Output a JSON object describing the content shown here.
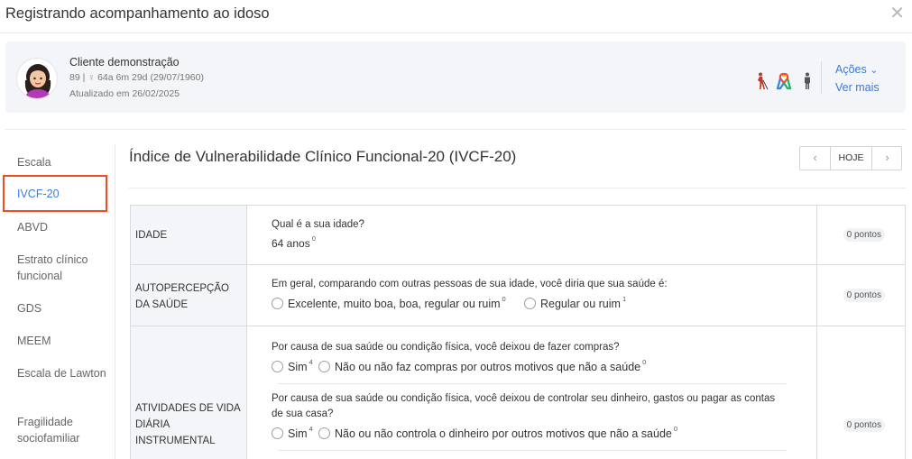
{
  "modal": {
    "title": "Registrando acompanhamento ao idoso",
    "close_glyph": "✕"
  },
  "patient": {
    "name": "Cliente demonstração",
    "id": "89",
    "separator": "|",
    "gender_symbol": "♀",
    "age_dob": "64a 6m 29d (29/07/1960)",
    "updated": "Atualizado em 26/02/2025",
    "icons": [
      "blind-person-icon",
      "ribbon-puzzle-icon",
      "person-standing-icon"
    ],
    "actions_label": "Ações",
    "actions_chevron": "⌄",
    "more_label": "Ver mais"
  },
  "sidebar": {
    "items": [
      {
        "label": "Escala"
      },
      {
        "label": "IVCF-20"
      },
      {
        "label": "ABVD"
      },
      {
        "label": "Estrato clínico funcional"
      },
      {
        "label": "GDS"
      },
      {
        "label": "MEEM"
      },
      {
        "label": "Escala de Lawton"
      },
      {
        "label": "Fragilidade sociofamiliar"
      }
    ],
    "active_index": 1
  },
  "scale": {
    "title": "Índice de Vulnerabilidade Clínico Funcional-20 (IVCF-20)",
    "pager": {
      "prev": "‹",
      "today": "HOJE",
      "next": "›"
    }
  },
  "rows": [
    {
      "category": "IDADE",
      "question": "Qual é a sua idade?",
      "answer": "64 anos",
      "answer_score": "0",
      "points": "0 pontos"
    },
    {
      "category": "AUTOPERCEPÇÃO DA SAÚDE",
      "question": "Em geral, comparando com outras pessoas de sua idade, você diria que sua saúde é:",
      "options": [
        {
          "label": "Excelente, muito boa, boa, regular ou ruim",
          "score": "0"
        },
        {
          "label": "Regular ou ruim",
          "score": "1"
        }
      ],
      "points": "0 pontos"
    },
    {
      "category": "ATIVIDADES DE VIDA DIÁRIA INSTRUMENTAL",
      "questions": [
        {
          "question": "Por causa de sua saúde ou condição física, você deixou de fazer compras?",
          "options": [
            {
              "label": "Sim",
              "score": "4"
            },
            {
              "label": "Não ou não faz compras por outros motivos que não a saúde",
              "score": "0"
            }
          ]
        },
        {
          "question": "Por causa de sua saúde ou condição física, você deixou de controlar seu dinheiro, gastos ou pagar as contas de sua casa?",
          "options": [
            {
              "label": "Sim",
              "score": "4"
            },
            {
              "label": "Não ou não controla o dinheiro por outros motivos que não a saúde",
              "score": "0"
            }
          ]
        }
      ],
      "points": "0 pontos"
    }
  ]
}
